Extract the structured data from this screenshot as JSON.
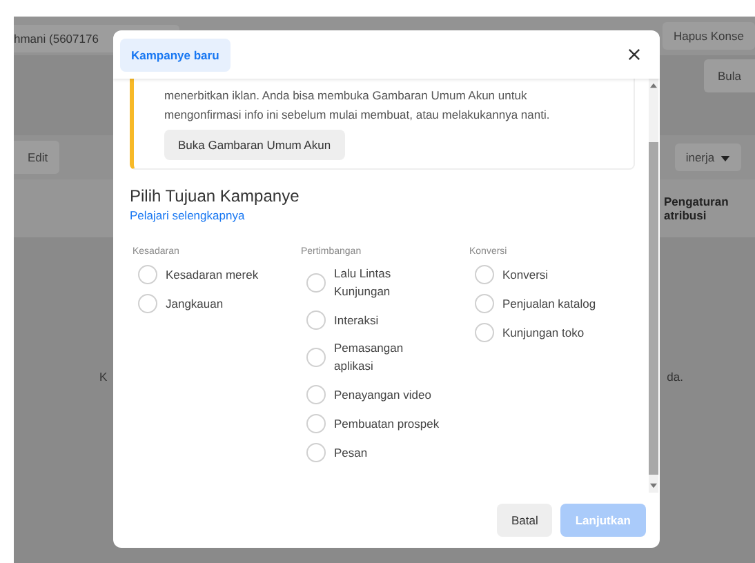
{
  "background": {
    "account_field": "hmani (5607176",
    "delete_draft_button": "Hapus Konse",
    "period_button": "Bula",
    "edit_button": "Edit",
    "performance_button": "inerja",
    "column_header": "Pengaturan atribusi",
    "text_fragment_left": "K",
    "text_fragment_right": "da."
  },
  "dialog": {
    "tab": {
      "label": "Kampanye baru",
      "selected": true
    },
    "notice": {
      "text": "menerbitkan iklan. Anda bisa membuka Gambaran Umum Akun untuk mengonfirmasi info ini sebelum mulai membuat, atau melakukannya nanti.",
      "button": "Buka Gambaran Umum Akun"
    },
    "heading": "Pilih Tujuan Kampanye",
    "link": "Pelajari selengkapnya",
    "groups": [
      {
        "title": "Kesadaran",
        "options": [
          {
            "label": "Kesadaran merek",
            "selected": false
          },
          {
            "label": "Jangkauan",
            "selected": false
          }
        ]
      },
      {
        "title": "Pertimbangan",
        "options": [
          {
            "label": "Lalu Lintas\nKunjungan",
            "selected": false
          },
          {
            "label": "Interaksi",
            "selected": false
          },
          {
            "label": "Pemasangan\naplikasi",
            "selected": false
          },
          {
            "label": "Penayangan video",
            "selected": false
          },
          {
            "label": "Pembuatan prospek",
            "selected": false
          },
          {
            "label": "Pesan",
            "selected": false
          }
        ]
      },
      {
        "title": "Konversi",
        "options": [
          {
            "label": "Konversi",
            "selected": false
          },
          {
            "label": "Penjualan katalog",
            "selected": false
          },
          {
            "label": "Kunjungan toko",
            "selected": false
          }
        ]
      }
    ],
    "buttons": [
      {
        "label": "Batal",
        "disabled": false
      },
      {
        "label": "Lanjutkan",
        "disabled": true
      }
    ]
  }
}
